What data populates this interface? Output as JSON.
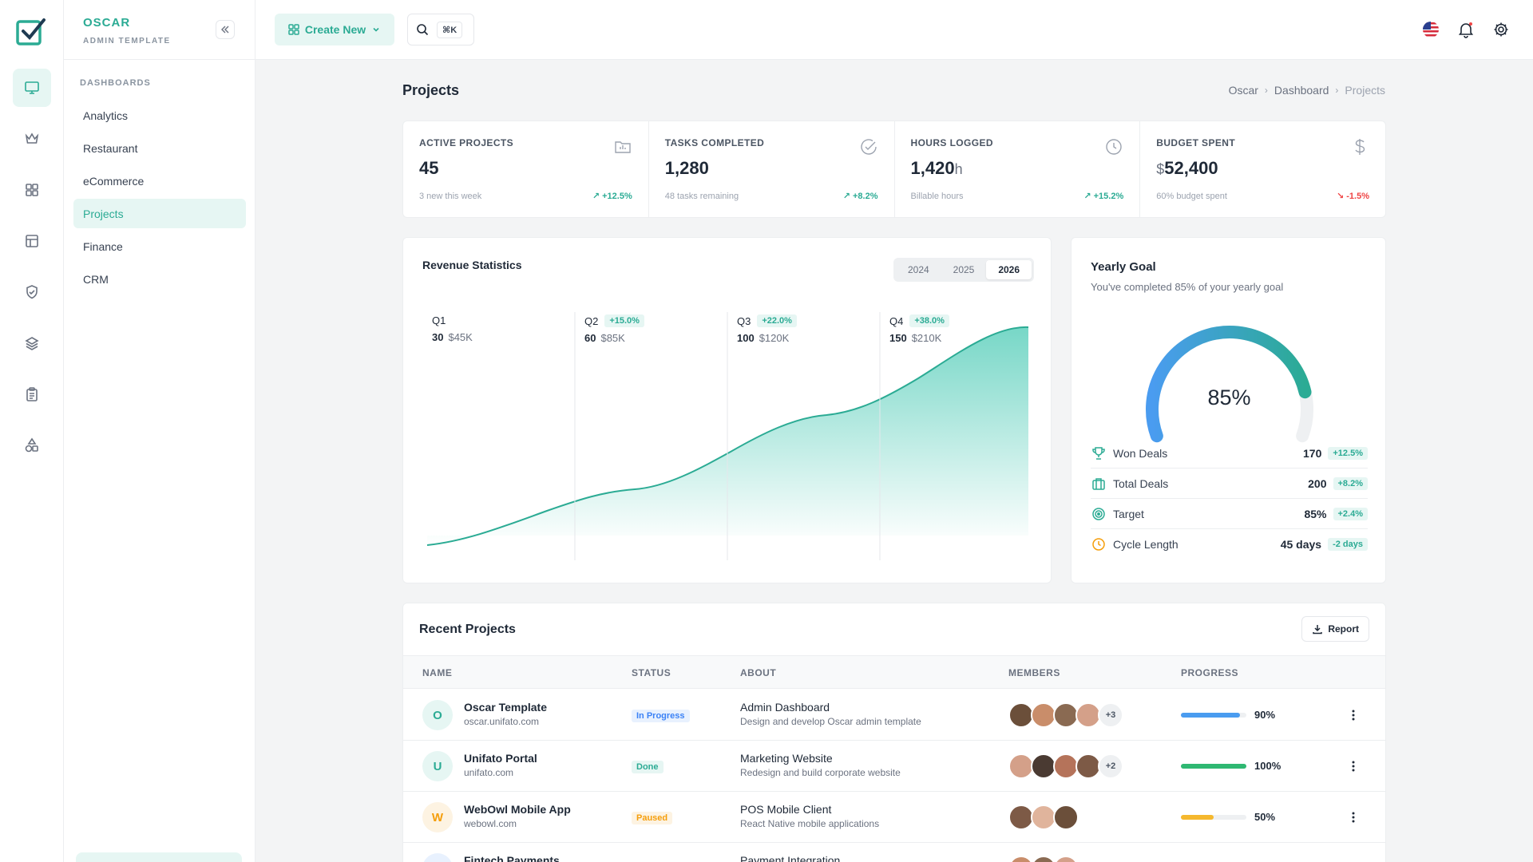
{
  "brand": {
    "name": "OSCAR",
    "subtitle": "ADMIN TEMPLATE"
  },
  "rail": {
    "icons": [
      "monitor-icon",
      "crown-icon",
      "grid-icon",
      "layout-icon",
      "shield-check-icon",
      "layers-icon",
      "clipboard-icon",
      "shapes-icon"
    ],
    "active": "monitor-icon"
  },
  "sidebar": {
    "section": "DASHBOARDS",
    "items": [
      {
        "label": "Analytics"
      },
      {
        "label": "Restaurant"
      },
      {
        "label": "eCommerce"
      },
      {
        "label": "Projects",
        "active": true
      },
      {
        "label": "Finance"
      },
      {
        "label": "CRM"
      }
    ]
  },
  "topbar": {
    "create_label": "Create New",
    "search_shortcut": "⌘K"
  },
  "page": {
    "title": "Projects",
    "breadcrumb": [
      "Oscar",
      "Dashboard",
      "Projects"
    ]
  },
  "stats": [
    {
      "label": "ACTIVE PROJECTS",
      "value": "45",
      "unit": "",
      "prefix": "",
      "sub": "3 new this week",
      "change": "+12.5%",
      "positive": true,
      "icon": "folder-icon"
    },
    {
      "label": "TASKS COMPLETED",
      "value": "1,280",
      "unit": "",
      "prefix": "",
      "sub": "48 tasks remaining",
      "change": "+8.2%",
      "positive": true,
      "icon": "check-circle-icon"
    },
    {
      "label": "HOURS LOGGED",
      "value": "1,420",
      "unit": "h",
      "prefix": "",
      "sub": "Billable hours",
      "change": "+15.2%",
      "positive": true,
      "icon": "clock-icon"
    },
    {
      "label": "BUDGET SPENT",
      "value": "52,400",
      "unit": "",
      "prefix": "$",
      "sub": "60% budget spent",
      "change": "-1.5%",
      "positive": false,
      "icon": "dollar-icon"
    }
  ],
  "revenue": {
    "title": "Revenue Statistics",
    "years": [
      "2024",
      "2025",
      "2026"
    ],
    "active_year": "2026",
    "quarters": [
      {
        "name": "Q1",
        "count": "30",
        "amount": "$45K",
        "change": ""
      },
      {
        "name": "Q2",
        "count": "60",
        "amount": "$85K",
        "change": "+15.0%"
      },
      {
        "name": "Q3",
        "count": "100",
        "amount": "$120K",
        "change": "+22.0%"
      },
      {
        "name": "Q4",
        "count": "150",
        "amount": "$210K",
        "change": "+38.0%"
      }
    ],
    "color": "#2bab94"
  },
  "goal": {
    "title": "Yearly Goal",
    "subtitle": "You've completed 85% of your yearly goal",
    "percent": 85,
    "percent_label": "85%",
    "rows": [
      {
        "label": "Won Deals",
        "value": "170",
        "change": "+12.5%",
        "icon": "trophy-icon",
        "color": "#2bab94"
      },
      {
        "label": "Total Deals",
        "value": "200",
        "change": "+8.2%",
        "icon": "briefcase-icon",
        "color": "#2bab94"
      },
      {
        "label": "Target",
        "value": "85%",
        "change": "+2.4%",
        "icon": "target-icon",
        "color": "#2bab94"
      },
      {
        "label": "Cycle Length",
        "value": "45 days",
        "change": "-2 days",
        "icon": "clock-icon",
        "color": "#f59e0b"
      }
    ]
  },
  "recent": {
    "title": "Recent Projects",
    "report_label": "Report",
    "columns": [
      "NAME",
      "STATUS",
      "ABOUT",
      "MEMBERS",
      "PROGRESS"
    ],
    "rows": [
      {
        "initial": "O",
        "name": "Oscar Template",
        "url": "oscar.unifato.com",
        "status": "In Progress",
        "status_type": "blue",
        "about_title": "Admin Dashboard",
        "about_desc": "Design and develop Oscar admin template",
        "members": 4,
        "more": "+3",
        "progress": 90,
        "progress_label": "90%",
        "bar_color": "#4a9cf0",
        "avatar_color": "#2bab94",
        "avatar_bg": "#e6f6f3"
      },
      {
        "initial": "U",
        "name": "Unifato Portal",
        "url": "unifato.com",
        "status": "Done",
        "status_type": "green",
        "about_title": "Marketing Website",
        "about_desc": "Redesign and build corporate website",
        "members": 4,
        "more": "+2",
        "progress": 100,
        "progress_label": "100%",
        "bar_color": "#2fb872",
        "avatar_color": "#2bab94",
        "avatar_bg": "#e6f6f3"
      },
      {
        "initial": "W",
        "name": "WebOwl Mobile App",
        "url": "webowl.com",
        "status": "Paused",
        "status_type": "amber",
        "about_title": "POS Mobile Client",
        "about_desc": "React Native mobile applications",
        "members": 3,
        "more": "",
        "progress": 50,
        "progress_label": "50%",
        "bar_color": "#f5b82e",
        "avatar_color": "#f59e0b",
        "avatar_bg": "#fdf3e2"
      },
      {
        "initial": "F",
        "name": "Fintech Payments",
        "url": "",
        "status": "",
        "status_type": "blue",
        "about_title": "Payment Integration",
        "about_desc": "",
        "members": 3,
        "more": "",
        "progress": 0,
        "progress_label": "",
        "bar_color": "#4a9cf0",
        "avatar_color": "#3b82f6",
        "avatar_bg": "#e8f1fe"
      }
    ]
  }
}
